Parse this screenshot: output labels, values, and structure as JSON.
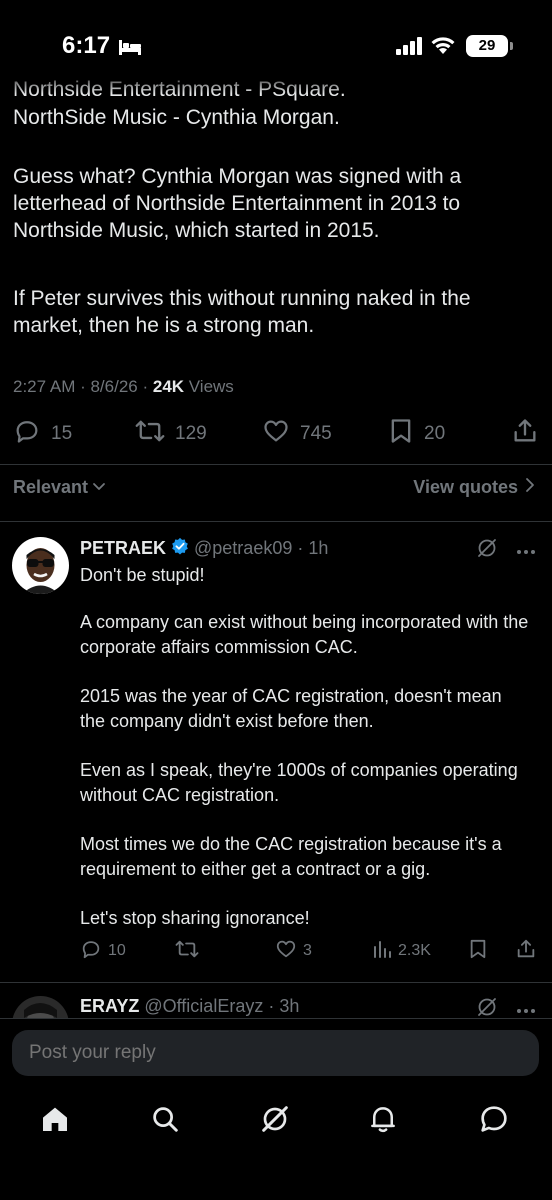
{
  "status_bar": {
    "time": "6:17",
    "battery": "29"
  },
  "tweet": {
    "partial_line": "Northside Entertainment - PSquare.",
    "line2": "NorthSide Music - Cynthia Morgan.",
    "paragraph2": "Guess what? Cynthia Morgan was signed with a letterhead of Northside Entertainment in 2013 to Northside Music, which started in 2015.",
    "paragraph3": "If Peter survives this without running naked in the market, then he is a strong man.",
    "time": "2:27 AM · 8/6/26 · ",
    "views_count": "24K",
    "views_label": " Views",
    "replies": "15",
    "reposts": "129",
    "likes": "745",
    "bookmarks": "20"
  },
  "filter": {
    "relevant": "Relevant",
    "view_quotes": "View quotes"
  },
  "reply1": {
    "name": "PETRAEK",
    "handle": "@petraek09",
    "time": "· 1h",
    "paragraphs": [
      "Don't be stupid!",
      "A company can exist without being incorporated with the corporate affairs commission CAC.",
      "2015 was the year of CAC registration, doesn't mean the company didn't exist before then.",
      "Even as I speak, they're 1000s of companies operating without CAC registration.",
      "Most times we do the CAC registration because it's a requirement to either get a contract or a gig.",
      "Let's stop sharing ignorance!"
    ],
    "replies": "10",
    "likes": "3",
    "views": "2.3K"
  },
  "reply2": {
    "name": "ERAYZ",
    "handle": "@OfficialErayz",
    "time": "· 3h"
  },
  "composer": {
    "placeholder": "Post your reply"
  },
  "colors": {
    "background": "#000000",
    "text": "#e7e9ea",
    "muted": "#71767b",
    "verified": "#1d9bf0",
    "divider": "#2f3336"
  },
  "icons": [
    "home-icon",
    "search-icon",
    "grok-icon",
    "notifications-icon",
    "messages-icon"
  ]
}
